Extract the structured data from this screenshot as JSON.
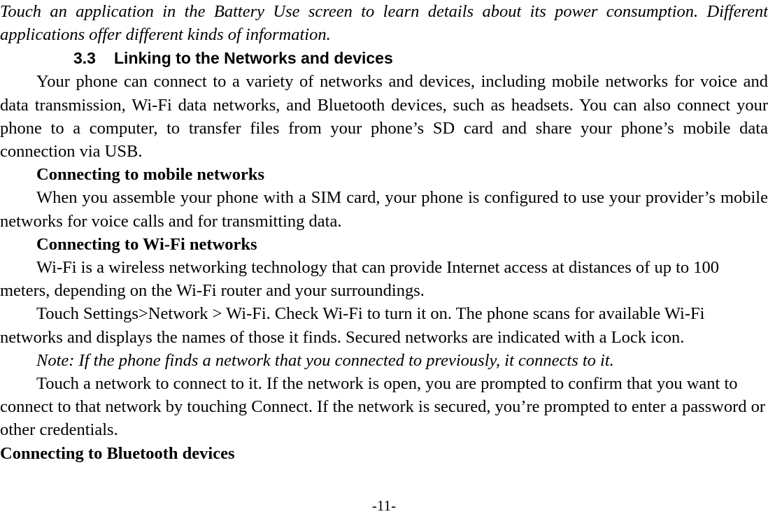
{
  "page": {
    "footer_label": "-11-",
    "background_color": "#ffffff",
    "text_color": "#000000"
  },
  "blocks": {
    "intro_note": "Touch an application in the Battery Use screen to learn details about its power consumption. Different applications offer different kinds of information.",
    "section": {
      "number": "3.3",
      "title": "Linking to the Networks and devices"
    },
    "intro_paragraph": "Your phone can connect to a variety of networks and devices, including mobile networks for voice and data transmission, Wi-Fi data networks, and Bluetooth devices, such as headsets. You can also connect your phone to a computer, to transfer files from your phone’s SD card and share your phone’s mobile data connection via USB.",
    "mobile_networks": {
      "heading": "Connecting to mobile networks",
      "body": "When you assemble your phone with a SIM card, your phone is configured to use your provider’s mobile networks for voice calls and for transmitting data."
    },
    "wifi_networks": {
      "heading": "Connecting to Wi-Fi networks",
      "paragraph_1": "Wi-Fi is a wireless networking technology that can provide Internet access at distances of up to 100 meters, depending on the Wi-Fi router and your surroundings.",
      "paragraph_2": "Touch Settings>Network > Wi-Fi. Check Wi-Fi to turn it on. The phone scans for available Wi-Fi networks and displays the names of those it finds. Secured networks are indicated with a Lock icon.",
      "note": "Note: If the phone finds a network that you connected to previously, it connects to it.",
      "paragraph_3": "Touch a network to connect to it. If the network is open, you are prompted to confirm that you want to connect to that network by touching Connect. If the network is secured, you’re prompted to enter a password or other credentials."
    },
    "bluetooth_devices": {
      "heading": "Connecting to Bluetooth devices"
    }
  }
}
